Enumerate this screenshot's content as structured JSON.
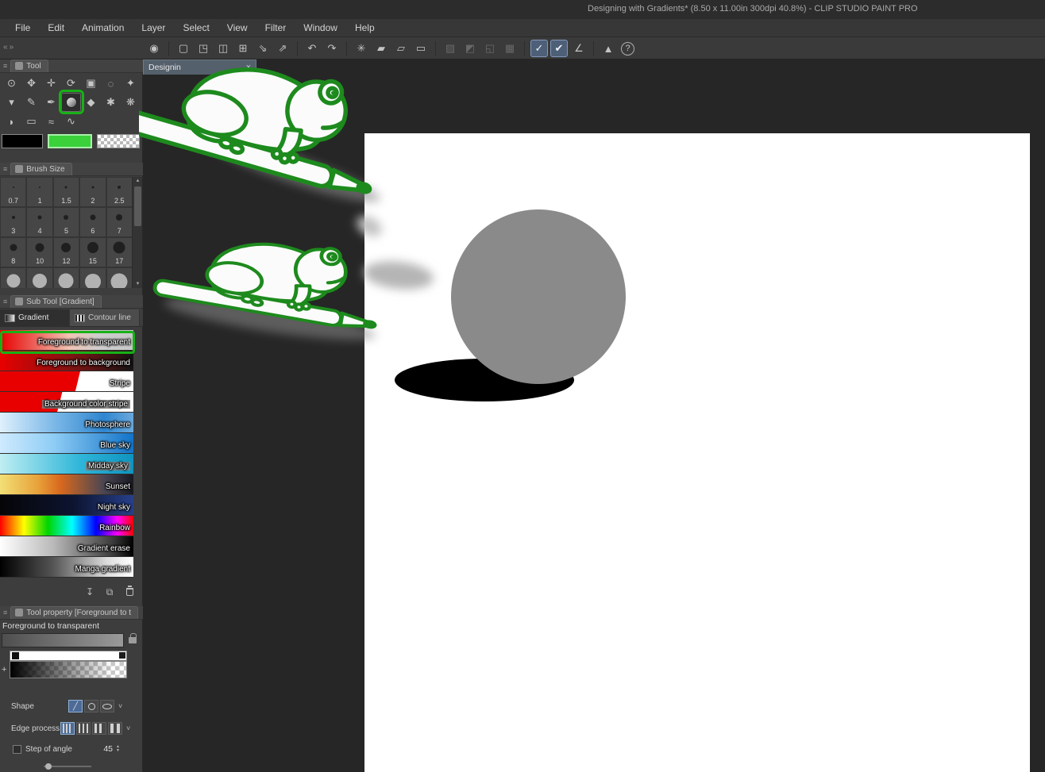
{
  "window": {
    "title": "Designing with Gradients* (8.50 x 11.00in 300dpi 40.8%)  - CLIP STUDIO PAINT PRO"
  },
  "menu": {
    "items": [
      "File",
      "Edit",
      "Animation",
      "Layer",
      "Select",
      "View",
      "Filter",
      "Window",
      "Help"
    ]
  },
  "toolbar": {
    "icons": [
      {
        "name": "clip-studio-icon",
        "glyph": "◉"
      },
      {
        "name": "new-canvas-icon",
        "glyph": "▢"
      },
      {
        "name": "open-file-icon",
        "glyph": "◳"
      },
      {
        "name": "save-icon",
        "glyph": "◫"
      },
      {
        "name": "save-all-icon",
        "glyph": "⊞"
      },
      {
        "name": "import-icon",
        "glyph": "⇘"
      },
      {
        "name": "export-icon",
        "glyph": "⇗"
      },
      {
        "name": "undo-icon",
        "glyph": "↶"
      },
      {
        "name": "redo-icon",
        "glyph": "↷"
      },
      {
        "name": "deselect-icon",
        "glyph": "✳"
      },
      {
        "name": "reselect-icon",
        "glyph": "▰"
      },
      {
        "name": "invert-selection-icon",
        "glyph": "▱"
      },
      {
        "name": "expand-selection-icon",
        "glyph": "▭"
      },
      {
        "name": "clear-selection-icon",
        "glyph": "▨"
      },
      {
        "name": "fill-selection-icon",
        "glyph": "◩"
      },
      {
        "name": "scale-rotate-icon",
        "glyph": "◱"
      },
      {
        "name": "mesh-transform-icon",
        "glyph": "▦"
      },
      {
        "name": "snap-to-ruler-icon",
        "glyph": "✓"
      },
      {
        "name": "snap-to-special-ruler-icon",
        "glyph": "✔"
      },
      {
        "name": "snap-to-grid-icon",
        "glyph": "∠"
      },
      {
        "name": "clip-studio-tips-icon",
        "glyph": "▲"
      },
      {
        "name": "help-icon",
        "glyph": "?"
      }
    ]
  },
  "icons": {
    "collapse_left": "«",
    "collapse_right": "»",
    "close": "×",
    "scroll_up": "▲",
    "scroll_down": "▼",
    "spin_up": "▲",
    "spin_down": "▼",
    "chevron_down": "˅",
    "plus": "+",
    "import": "↧",
    "duplicate": "⧉"
  },
  "document_tab": {
    "label": "Designin"
  },
  "tool_panel": {
    "title": "Tool",
    "tools": [
      {
        "name": "zoom-tool-icon",
        "glyph": "⊙"
      },
      {
        "name": "hand-tool-icon",
        "glyph": "✥"
      },
      {
        "name": "move-tool-icon",
        "glyph": "✛"
      },
      {
        "name": "rotate-tool-icon",
        "glyph": "⟳"
      },
      {
        "name": "operation-tool-icon",
        "glyph": "▣"
      },
      {
        "name": "selection-tool-icon",
        "glyph": "◌"
      },
      {
        "name": "auto-select-tool-icon",
        "glyph": "✦"
      },
      {
        "name": "eyedropper-tool-icon",
        "glyph": "▾"
      },
      {
        "name": "pen-tool-icon",
        "glyph": "✎"
      },
      {
        "name": "brush-tool-icon",
        "glyph": "✒"
      },
      {
        "name": "gradient-tool-icon",
        "glyph": ""
      },
      {
        "name": "fill-tool-icon",
        "glyph": "◆"
      },
      {
        "name": "airbrush-tool-icon",
        "glyph": "✱"
      },
      {
        "name": "decoration-tool-icon",
        "glyph": "❋"
      },
      {
        "name": "balloon-tool-icon",
        "glyph": "◗"
      },
      {
        "name": "eraser-tool-icon",
        "glyph": "▭"
      },
      {
        "name": "blend-tool-icon",
        "glyph": "≈"
      },
      {
        "name": "liquify-tool-icon",
        "glyph": "∿"
      }
    ]
  },
  "color_swatches": {
    "main_color": "#000000",
    "sub_color": "#3bd13b"
  },
  "brush_size_panel": {
    "title": "Brush Size",
    "sizes": [
      "0.7",
      "1",
      "1.5",
      "2",
      "2.5",
      "3",
      "4",
      "5",
      "6",
      "7",
      "8",
      "10",
      "12",
      "15",
      "17"
    ]
  },
  "sub_tool_panel": {
    "title": "Sub Tool [Gradient]",
    "tabs": [
      "Gradient",
      "Contour line"
    ],
    "presets": [
      {
        "label": "Foreground to transparent"
      },
      {
        "label": "Foreground to background"
      },
      {
        "label": "Stripe"
      },
      {
        "label": "Background color stripe"
      },
      {
        "label": "Photosphere"
      },
      {
        "label": "Blue sky"
      },
      {
        "label": "Midday sky"
      },
      {
        "label": "Sunset"
      },
      {
        "label": "Night sky"
      },
      {
        "label": "Rainbow"
      },
      {
        "label": "Gradient erase"
      },
      {
        "label": "Manga gradient"
      }
    ]
  },
  "tool_property_panel": {
    "title": "Tool property [Foreground to t",
    "preset_name": "Foreground to transparent",
    "shape_label": "Shape",
    "edge_label": "Edge process",
    "step_label": "Step of angle",
    "step_value": "45"
  },
  "canvas": {
    "background": "#ffffff",
    "sphere_color": "#8a8a8a",
    "shadow_color": "#000000"
  },
  "annotation_color": "#17b117",
  "illustration": {
    "frog_outline": "#1d8a1d",
    "frog_fill": "#fbfbfb"
  }
}
